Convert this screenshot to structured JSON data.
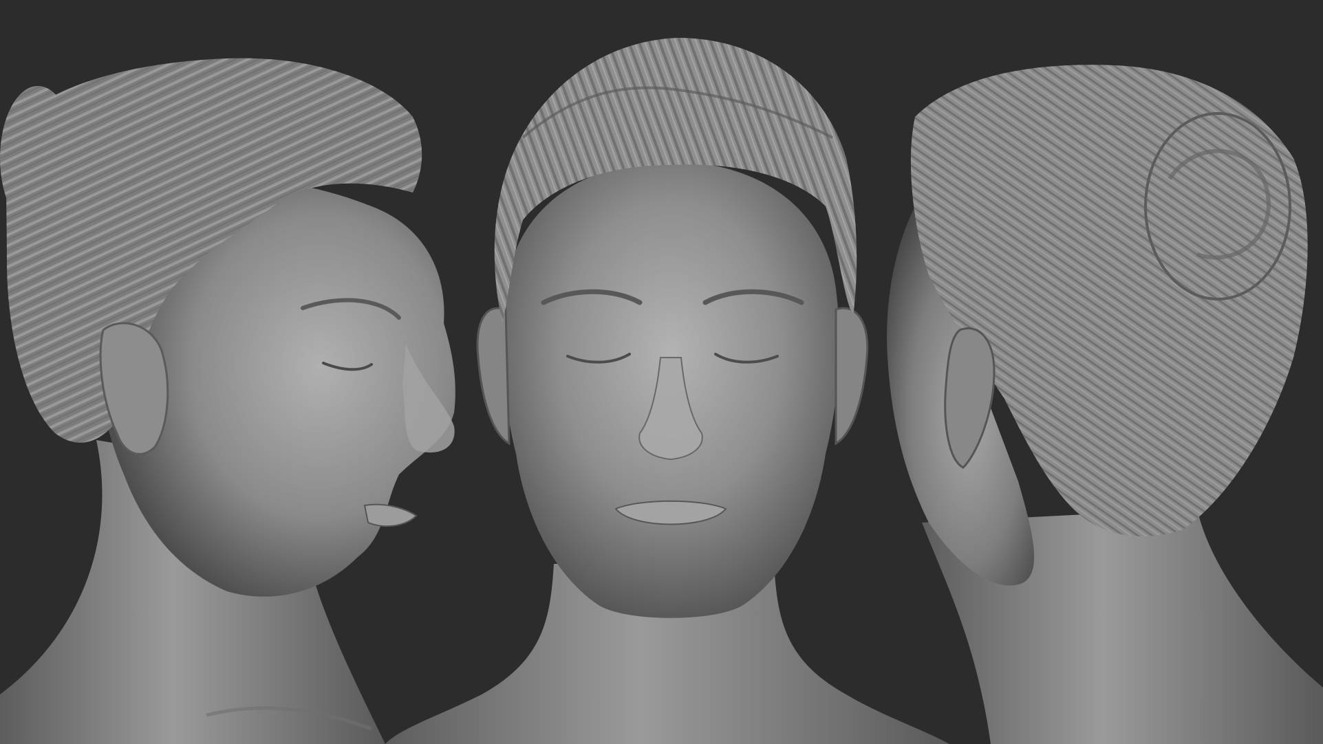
{
  "scene": {
    "background_color": "#2c2c2c",
    "clay_color": "#8e8e8e",
    "clay_highlight": "#bdbdbd",
    "clay_shadow": "#4a4a4a",
    "views": [
      {
        "name": "three-quarter-left"
      },
      {
        "name": "front"
      },
      {
        "name": "back-three-quarter-right"
      }
    ]
  }
}
